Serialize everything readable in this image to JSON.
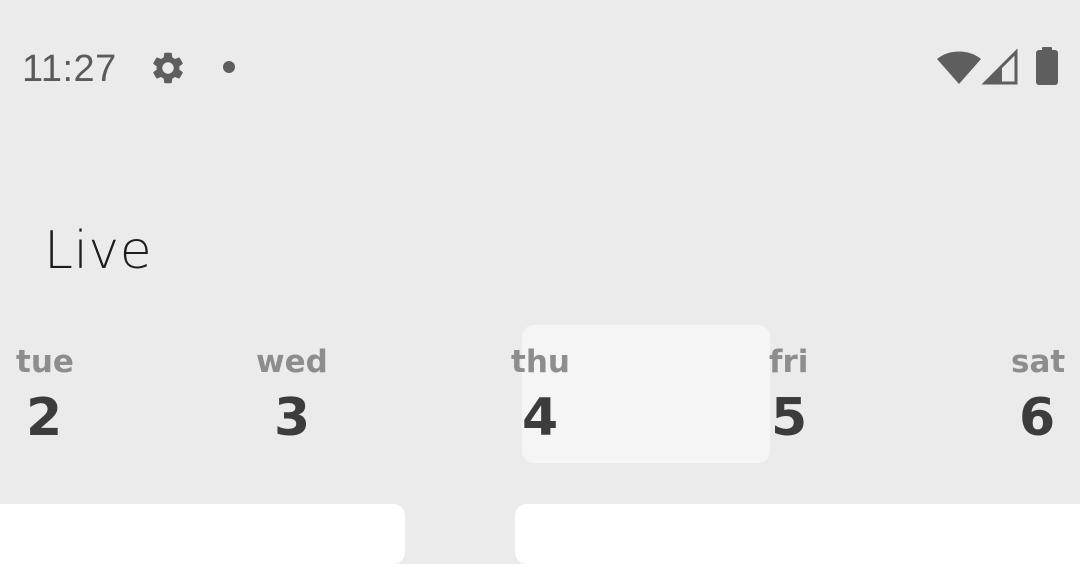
{
  "status_bar": {
    "time": "11:27",
    "icons": [
      "gear-icon",
      "notification-dot-icon",
      "wifi-icon",
      "cell-signal-icon",
      "battery-icon"
    ]
  },
  "page": {
    "title": "Live"
  },
  "days": [
    {
      "name": "tue",
      "number": "2"
    },
    {
      "name": "wed",
      "number": "3"
    },
    {
      "name": "thu",
      "number": "4",
      "selected": true
    },
    {
      "name": "fri",
      "number": "5"
    },
    {
      "name": "sat",
      "number": "6"
    }
  ],
  "colors": {
    "background": "#ebebeb",
    "selected_day_bg": "#f5f5f5",
    "day_name": "#8d8d8d",
    "day_number": "#3c3c3c",
    "card": "#ffffff"
  }
}
